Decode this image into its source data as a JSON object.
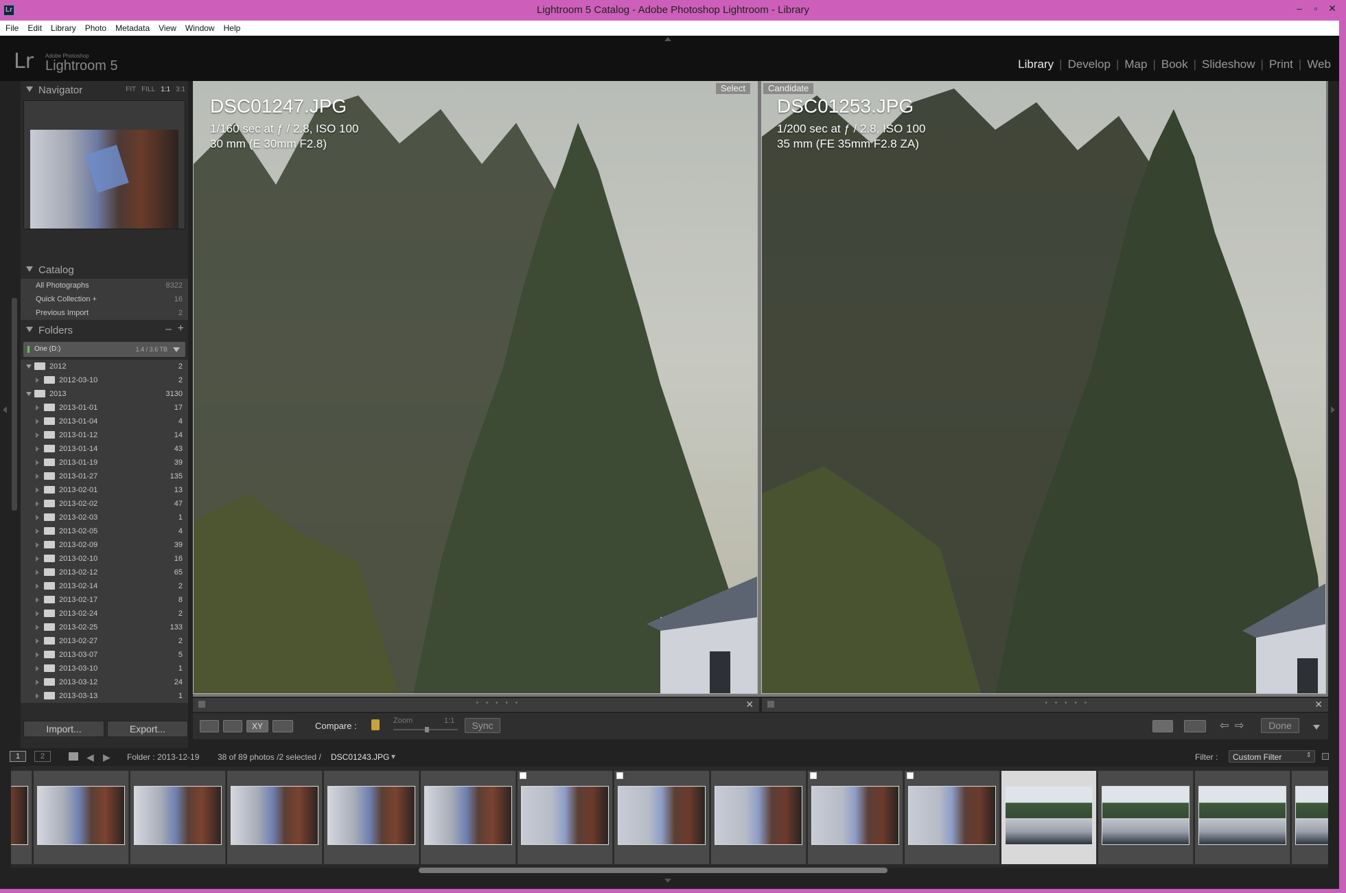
{
  "window": {
    "title": "Lightroom 5 Catalog - Adobe Photoshop Lightroom - Library",
    "app_icon": "Lr"
  },
  "menu": [
    "File",
    "Edit",
    "Library",
    "Photo",
    "Metadata",
    "View",
    "Window",
    "Help"
  ],
  "logo": {
    "mark": "Lr",
    "small": "Adobe Photoshop",
    "big": "Lightroom 5"
  },
  "modules": [
    "Library",
    "Develop",
    "Map",
    "Book",
    "Slideshow",
    "Print",
    "Web"
  ],
  "active_module": "Library",
  "navigator": {
    "title": "Navigator",
    "options": [
      "FIT",
      "FILL",
      "1:1",
      "3:1"
    ],
    "selected_option": "1:1"
  },
  "catalog": {
    "title": "Catalog",
    "items": [
      {
        "label": "All Photographs",
        "count": "8322"
      },
      {
        "label": "Quick Collection +",
        "count": "16"
      },
      {
        "label": "Previous Import",
        "count": "2"
      }
    ]
  },
  "folders": {
    "title": "Folders",
    "minus": "–",
    "plus": "+",
    "volume": {
      "label": "One (D:)",
      "usage": "1.4 / 3.6 TB"
    },
    "items": [
      {
        "label": "2012",
        "count": "2",
        "level": 0
      },
      {
        "label": "2012-03-10",
        "count": "2",
        "level": 1
      },
      {
        "label": "2013",
        "count": "3130",
        "level": 0
      },
      {
        "label": "2013-01-01",
        "count": "17",
        "level": 1
      },
      {
        "label": "2013-01-04",
        "count": "4",
        "level": 1
      },
      {
        "label": "2013-01-12",
        "count": "14",
        "level": 1
      },
      {
        "label": "2013-01-14",
        "count": "43",
        "level": 1
      },
      {
        "label": "2013-01-19",
        "count": "39",
        "level": 1
      },
      {
        "label": "2013-01-27",
        "count": "135",
        "level": 1
      },
      {
        "label": "2013-02-01",
        "count": "13",
        "level": 1
      },
      {
        "label": "2013-02-02",
        "count": "47",
        "level": 1
      },
      {
        "label": "2013-02-03",
        "count": "1",
        "level": 1
      },
      {
        "label": "2013-02-05",
        "count": "4",
        "level": 1
      },
      {
        "label": "2013-02-09",
        "count": "39",
        "level": 1
      },
      {
        "label": "2013-02-10",
        "count": "16",
        "level": 1
      },
      {
        "label": "2013-02-12",
        "count": "65",
        "level": 1
      },
      {
        "label": "2013-02-14",
        "count": "2",
        "level": 1
      },
      {
        "label": "2013-02-17",
        "count": "8",
        "level": 1
      },
      {
        "label": "2013-02-24",
        "count": "2",
        "level": 1
      },
      {
        "label": "2013-02-25",
        "count": "133",
        "level": 1
      },
      {
        "label": "2013-02-27",
        "count": "2",
        "level": 1
      },
      {
        "label": "2013-03-07",
        "count": "5",
        "level": 1
      },
      {
        "label": "2013-03-10",
        "count": "1",
        "level": 1
      },
      {
        "label": "2013-03-12",
        "count": "24",
        "level": 1
      },
      {
        "label": "2013-03-13",
        "count": "1",
        "level": 1
      }
    ]
  },
  "buttons": {
    "import": "Import...",
    "export": "Export..."
  },
  "compare": {
    "select": {
      "tag": "Select",
      "filename": "DSC01247.JPG",
      "exposure": "1/160 sec at ƒ / 2.8, ISO 100",
      "lens": "30 mm (E 30mm F2.8)"
    },
    "candidate": {
      "tag": "Candidate",
      "filename": "DSC01253.JPG",
      "exposure": "1/200 sec at ƒ / 2.8, ISO 100",
      "lens": "35 mm (FE 35mm F2.8 ZA)"
    },
    "close_symbol": "✕",
    "dots": "• • • • •"
  },
  "toolbar": {
    "compare_label": "Compare :",
    "zoom_label": "Zoom",
    "zoom_value": "1:1",
    "sync_label": "Sync",
    "done_label": "Done",
    "xy_label": "XY"
  },
  "filmbar": {
    "page1": "1",
    "page2": "2",
    "folder": "Folder : 2013-12-19",
    "selection": "38 of 89 photos /2 selected /",
    "current_file": "DSC01243.JPG",
    "filter_label": "Filter :",
    "filter_value": "Custom Filter"
  },
  "filmstrip": {
    "thumbs": [
      {
        "variant": "tB",
        "flagged": false,
        "selected": false
      },
      {
        "variant": "tA",
        "flagged": false,
        "selected": false
      },
      {
        "variant": "tA",
        "flagged": false,
        "selected": false
      },
      {
        "variant": "tA",
        "flagged": false,
        "selected": false
      },
      {
        "variant": "tA",
        "flagged": false,
        "selected": false
      },
      {
        "variant": "tA",
        "flagged": false,
        "selected": false
      },
      {
        "variant": "tB",
        "flagged": true,
        "selected": false
      },
      {
        "variant": "tB",
        "flagged": true,
        "selected": false
      },
      {
        "variant": "tB",
        "flagged": false,
        "selected": false
      },
      {
        "variant": "tB",
        "flagged": true,
        "selected": false
      },
      {
        "variant": "tB",
        "flagged": true,
        "selected": false
      },
      {
        "variant": "tC",
        "flagged": false,
        "selected": true
      },
      {
        "variant": "tC",
        "flagged": false,
        "selected": false
      },
      {
        "variant": "tC",
        "flagged": false,
        "selected": false
      },
      {
        "variant": "tC",
        "flagged": false,
        "selected": false
      }
    ]
  }
}
